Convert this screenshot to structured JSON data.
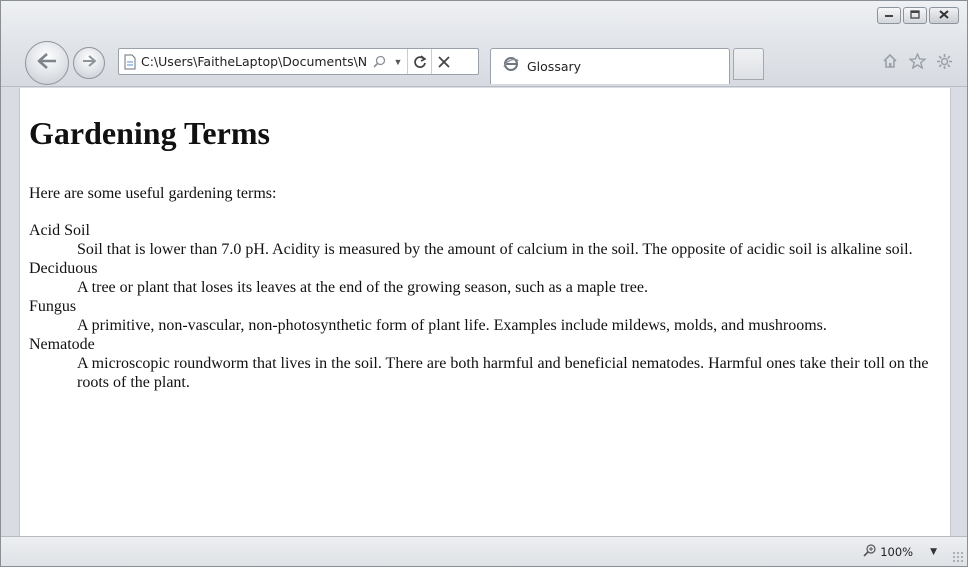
{
  "window": {
    "controls": [
      "minimize-icon",
      "maximize-icon",
      "close-icon"
    ]
  },
  "toolbar": {
    "address": "C:\\Users\\FaitheLaptop\\Documents\\N",
    "icons": [
      "back-arrow-icon",
      "forward-arrow-icon",
      "page-icon",
      "search-icon",
      "chevron-down-icon",
      "refresh-icon",
      "stop-icon",
      "home-icon",
      "star-icon",
      "gear-icon"
    ]
  },
  "tabs": [
    {
      "label": "Glossary",
      "icon": "ie-icon"
    }
  ],
  "page": {
    "title": "Gardening Terms",
    "intro": "Here are some useful gardening terms:",
    "terms": [
      {
        "term": "Acid Soil",
        "definition": "Soil that is lower than 7.0 pH. Acidity is measured by the amount of calcium in the soil. The opposite of acidic soil is alkaline soil."
      },
      {
        "term": "Deciduous",
        "definition": "A tree or plant that loses its leaves at the end of the growing season, such as a maple tree."
      },
      {
        "term": "Fungus",
        "definition": "A primitive, non-vascular, non-photosynthetic form of plant life. Examples include mildews, molds, and mushrooms."
      },
      {
        "term": "Nematode",
        "definition": "A microscopic roundworm that lives in the soil. There are both harmful and beneficial nematodes. Harmful ones take their toll on the roots of the plant."
      }
    ]
  },
  "statusbar": {
    "zoom": "100%",
    "zoom_icon": "zoom-icon"
  }
}
